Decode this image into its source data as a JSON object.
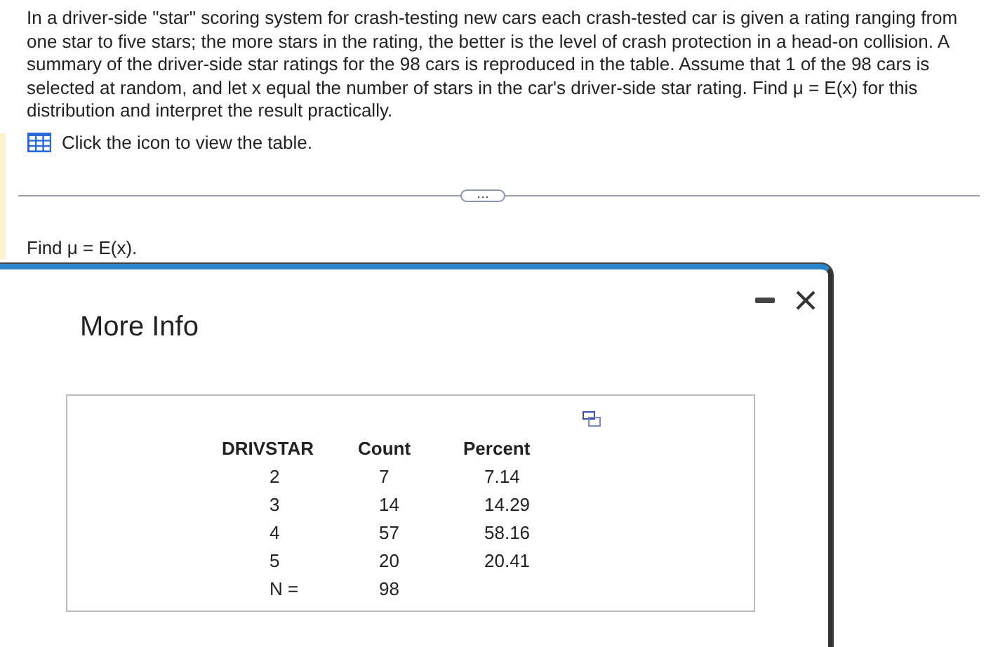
{
  "question": {
    "text": "In a driver-side \"star\" scoring system for crash-testing new cars each crash-tested car is given a rating ranging from one star to five stars; the more stars in the rating, the better is the level of crash protection in a head-on collision. A summary of the driver-side star ratings for the 98 cars is reproduced in the table. Assume that 1 of the 98 cars is selected at random, and let x equal the number of stars in the car's driver-side star rating. Find μ = E(x) for this distribution and interpret the result practically.",
    "table_link": "Click the icon to view the table.",
    "expand_button": "⋯",
    "prompt": "Find μ = E(x)."
  },
  "dialog": {
    "title": "More Info",
    "table": {
      "columns": [
        "DRIVSTAR",
        "Count",
        "Percent"
      ],
      "rows": [
        [
          "2",
          "7",
          "7.14"
        ],
        [
          "3",
          "14",
          "14.29"
        ],
        [
          "4",
          "57",
          "58.16"
        ],
        [
          "5",
          "20",
          "20.41"
        ],
        [
          "N =",
          "98"
        ]
      ]
    }
  }
}
